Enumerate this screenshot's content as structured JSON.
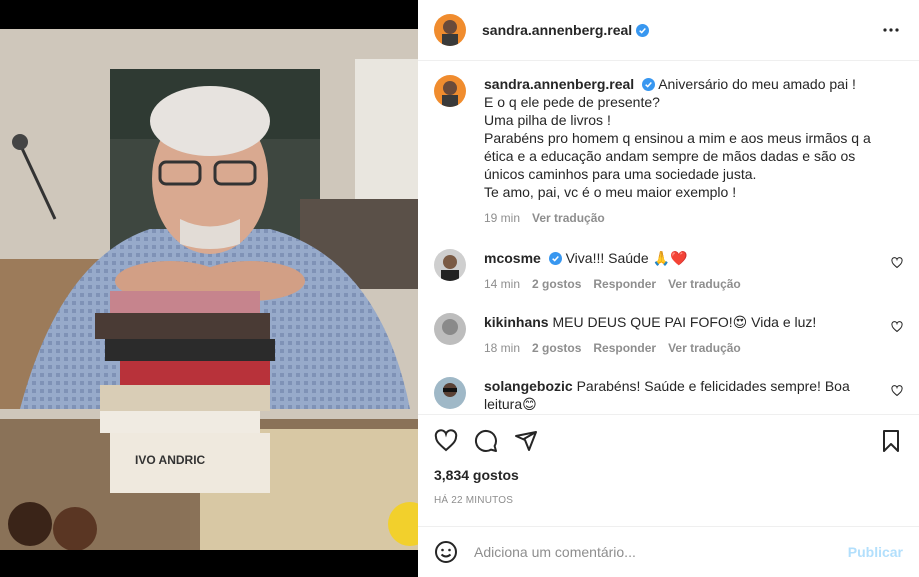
{
  "post": {
    "username": "sandra.annenberg.real",
    "caption_lines": [
      "Aniversário do meu amado pai !",
      "E o q ele pede de presente?",
      "Uma pilha de livros !",
      "Parabéns pro homem q ensinou a mim e aos meus irmãos q a ética e a educação andam sempre de mãos dadas e são os únicos caminhos para uma sociedade justa.",
      "Te amo, pai, vc é o meu maior exemplo !"
    ],
    "caption_time": "19 min",
    "caption_translate": "Ver tradução",
    "likes": "3,834 gostos",
    "posted": "HÁ 22 MINUTOS",
    "book_title": "IVO ANDRIC"
  },
  "comments": [
    {
      "user": "mcosme",
      "verified": true,
      "text": "Viva!!! Saúde 🙏❤️",
      "time": "14 min",
      "likes": "2 gostos",
      "reply": "Responder",
      "translate": "Ver tradução"
    },
    {
      "user": "kikinhans",
      "verified": false,
      "text": "MEU DEUS QUE PAI FOFO!😍 Vida e luz!",
      "time": "18 min",
      "likes": "2 gostos",
      "reply": "Responder",
      "translate": "Ver tradução"
    },
    {
      "user": "solangebozic",
      "verified": false,
      "text": "Parabéns! Saúde e felicidades sempre! Boa leitura😊",
      "time": "",
      "likes": "",
      "reply": "",
      "translate": ""
    }
  ],
  "add_comment": {
    "placeholder": "Adiciona um comentário...",
    "publish": "Publicar"
  },
  "colors": {
    "verified": "#3897f0",
    "like_heart": "#ed4956",
    "publish": "#b2dffc"
  },
  "icons": [
    "more-options-icon",
    "heart-icon",
    "comment-icon",
    "share-icon",
    "bookmark-icon",
    "emoji-icon",
    "verified-icon"
  ]
}
